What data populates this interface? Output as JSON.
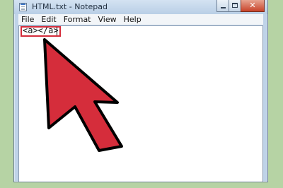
{
  "window": {
    "title": "HTML.txt - Notepad"
  },
  "menu": {
    "items": [
      {
        "label": "File"
      },
      {
        "label": "Edit"
      },
      {
        "label": "Format"
      },
      {
        "label": "View"
      },
      {
        "label": "Help"
      }
    ]
  },
  "editor": {
    "text": "<a></a>"
  },
  "colors": {
    "background": "#b6d3a4",
    "accent_red": "#d52d3b",
    "window_frame": "#bfd3e8"
  },
  "icons": {
    "app": "notepad-icon",
    "minimize": "minimize-icon",
    "maximize": "maximize-icon",
    "close": "close-icon",
    "pointer": "cursor-arrow-icon"
  },
  "controls": {
    "close_glyph": "✕"
  }
}
